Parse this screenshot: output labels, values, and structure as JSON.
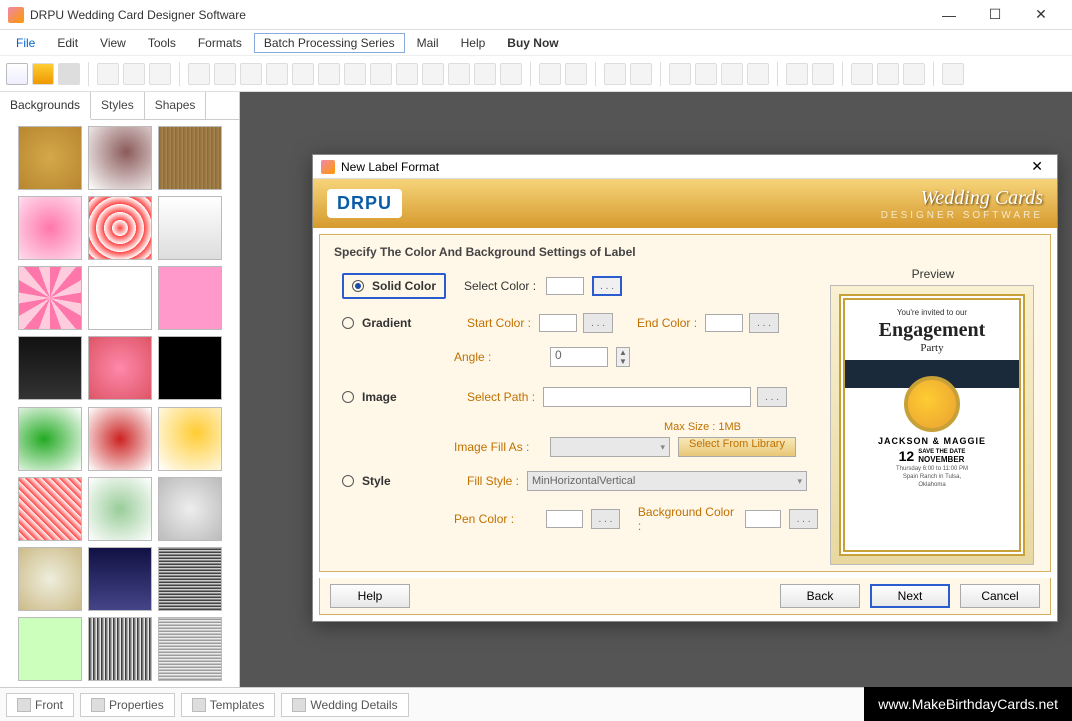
{
  "window": {
    "title": "DRPU Wedding Card Designer Software"
  },
  "menu": {
    "file": "File",
    "edit": "Edit",
    "view": "View",
    "tools": "Tools",
    "formats": "Formats",
    "batch": "Batch Processing Series",
    "mail": "Mail",
    "help": "Help",
    "buy": "Buy Now"
  },
  "side_tabs": {
    "backgrounds": "Backgrounds",
    "styles": "Styles",
    "shapes": "Shapes"
  },
  "dialog": {
    "title": "New Label Format",
    "logo": "DRPU",
    "brand_script": "Wedding Cards",
    "brand_sub": "DESIGNER SOFTWARE",
    "heading": "Specify The Color And Background Settings of Label",
    "solid": "Solid Color",
    "select_color": "Select Color :",
    "gradient": "Gradient",
    "start_color": "Start Color :",
    "end_color": "End Color :",
    "angle": "Angle :",
    "angle_val": "0",
    "image": "Image",
    "select_path": "Select Path :",
    "max_size": "Max Size : 1MB",
    "image_fill": "Image Fill As :",
    "from_library": "Select From Library",
    "style": "Style",
    "fill_style": "Fill Style :",
    "fill_style_val": "MinHorizontalVertical",
    "pen_color": "Pen Color :",
    "bg_color": "Background Color :",
    "preview": "Preview",
    "help": "Help",
    "back": "Back",
    "next": "Next",
    "cancel": "Cancel"
  },
  "preview_card": {
    "invited": "You're invited to our",
    "engagement": "Engagement",
    "party": "Party",
    "names": "JACKSON & MAGGIE",
    "day": "12",
    "save": "SAVE THE DATE",
    "month": "NOVEMBER",
    "details": "Thursday 6:00 to 11:00 PM\nSpain Ranch in Tulsa,\nOklahoma"
  },
  "status": {
    "front": "Front",
    "properties": "Properties",
    "templates": "Templates",
    "wedding": "Wedding Details"
  },
  "watermark": "www.MakeBirthdayCards.net"
}
